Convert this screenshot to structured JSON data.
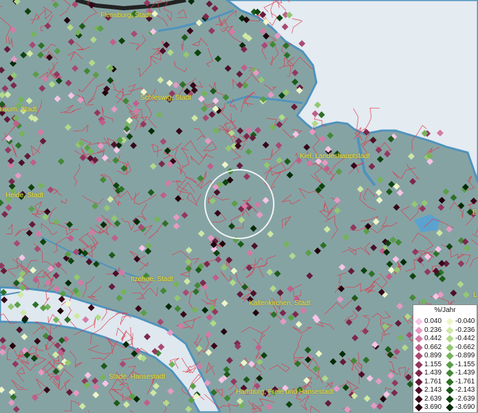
{
  "map": {
    "cities": [
      {
        "key": "flensburg",
        "label": "Flensburg, Stadt"
      },
      {
        "key": "schleswig",
        "label": "Schleswig, Stadt"
      },
      {
        "key": "husum",
        "label": "usum, Stadt"
      },
      {
        "key": "kiel",
        "label": "Kiel, Landeshauptstadt"
      },
      {
        "key": "heide",
        "label": "Heide, Stadt"
      },
      {
        "key": "itzehoe",
        "label": "Itzehoe, Stadt"
      },
      {
        "key": "kaltenkirchen",
        "label": "Kaltenkirchen, Stadt"
      },
      {
        "key": "stade",
        "label": "Stade, Hansestadt"
      },
      {
        "key": "hamburg",
        "label": "Hamburg, Freie und Hansestadt"
      },
      {
        "key": "edge_e",
        "label": "E"
      },
      {
        "key": "edge_l",
        "label": "L"
      }
    ],
    "colors": {
      "land": "#86a3a4",
      "sea": "#e8eef3",
      "river": "#4f93bd",
      "boundary": "#e0394a",
      "label": "#f3e22a",
      "highlight_circle": "#ffffff"
    }
  },
  "legend": {
    "title": "%/Jahr",
    "positive": [
      {
        "value": "0.040",
        "color": "#f6c4e6"
      },
      {
        "value": "0.236",
        "color": "#e59ac4"
      },
      {
        "value": "0.442",
        "color": "#d27ba5"
      },
      {
        "value": "0.662",
        "color": "#bf5f8a"
      },
      {
        "value": "0.899",
        "color": "#a84a73"
      },
      {
        "value": "1.155",
        "color": "#92385f"
      },
      {
        "value": "1.439",
        "color": "#7c284c"
      },
      {
        "value": "1.761",
        "color": "#651b3a"
      },
      {
        "value": "2.143",
        "color": "#4e0f29"
      },
      {
        "value": "2.639",
        "color": "#370719"
      },
      {
        "value": "3.690",
        "color": "#22020b"
      }
    ],
    "negative": [
      {
        "value": "-0.040",
        "color": "#eef6c8"
      },
      {
        "value": "-0.236",
        "color": "#cfe8a3"
      },
      {
        "value": "-0.442",
        "color": "#b2d98a"
      },
      {
        "value": "-0.662",
        "color": "#94c772"
      },
      {
        "value": "-0.899",
        "color": "#76b35c"
      },
      {
        "value": "-1.155",
        "color": "#5b9e48"
      },
      {
        "value": "-1.439",
        "color": "#438836"
      },
      {
        "value": "-1.761",
        "color": "#2e7127"
      },
      {
        "value": "-2.143",
        "color": "#1d5b1a"
      },
      {
        "value": "-2.639",
        "color": "#0f430e"
      },
      {
        "value": "-3.690",
        "color": "#052a06"
      }
    ]
  }
}
